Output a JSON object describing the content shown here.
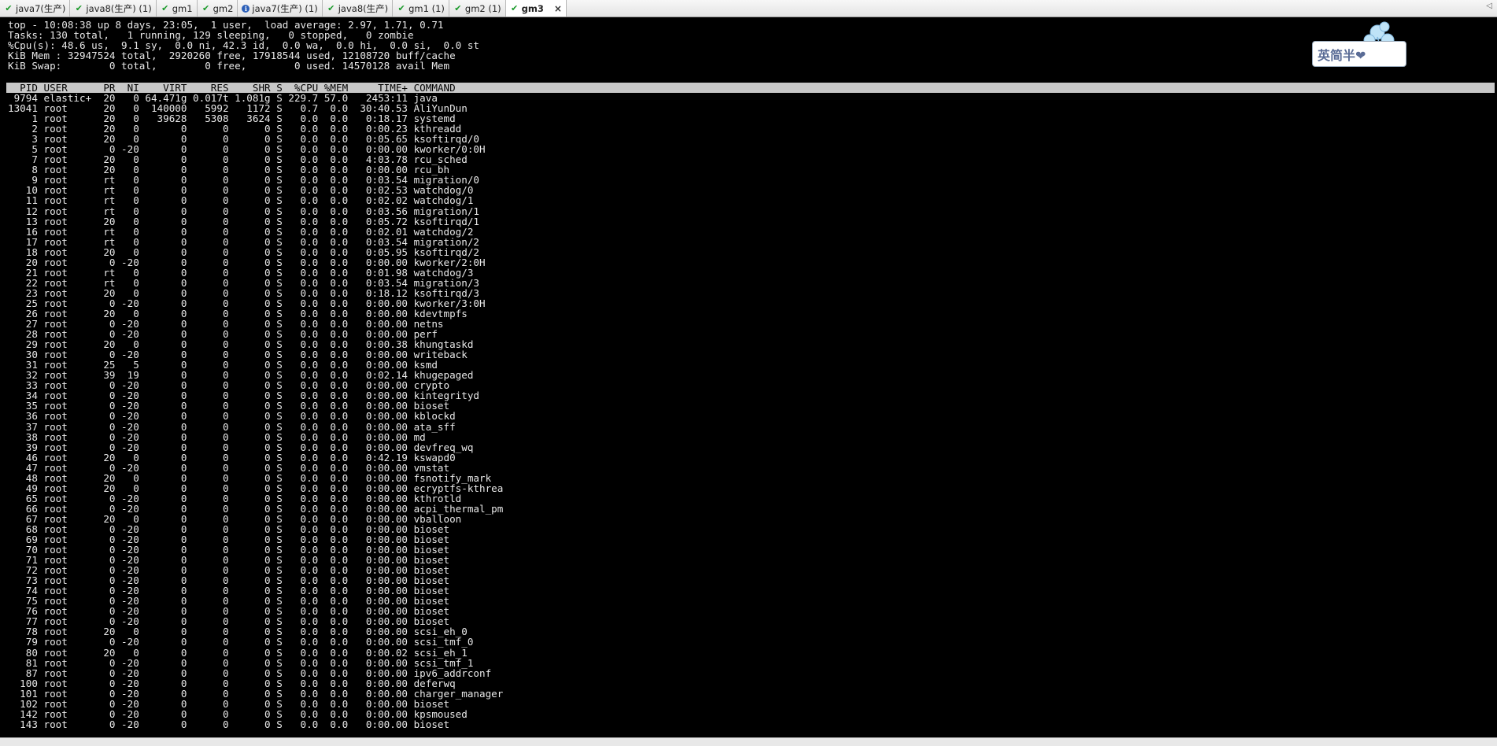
{
  "tabs": [
    {
      "label": "java7(生产)",
      "icon": "check-icon",
      "active": false
    },
    {
      "label": "java8(生产) (1)",
      "icon": "check-icon",
      "active": false
    },
    {
      "label": "gm1",
      "icon": "check-icon",
      "active": false
    },
    {
      "label": "gm2",
      "icon": "check-icon",
      "active": false
    },
    {
      "label": "java7(生产) (1)",
      "icon": "info-icon",
      "active": false
    },
    {
      "label": "java8(生产)",
      "icon": "check-icon",
      "active": false
    },
    {
      "label": "gm1 (1)",
      "icon": "check-icon",
      "active": false
    },
    {
      "label": "gm2 (1)",
      "icon": "check-icon",
      "active": false
    },
    {
      "label": "gm3",
      "icon": "check-icon",
      "active": true
    }
  ],
  "tab_close_label": "×",
  "tabbar_end_label": "◁",
  "logo_text": "英简半❤",
  "summary": [
    "top - 10:08:38 up 8 days, 23:05,  1 user,  load average: 2.97, 1.71, 0.71",
    "Tasks: 130 total,   1 running, 129 sleeping,   0 stopped,   0 zombie",
    "%Cpu(s): 48.6 us,  9.1 sy,  0.0 ni, 42.3 id,  0.0 wa,  0.0 hi,  0.0 si,  0.0 st",
    "KiB Mem : 32947524 total,  2920260 free, 17918544 used, 12108720 buff/cache",
    "KiB Swap:        0 total,        0 free,        0 used. 14570128 avail Mem"
  ],
  "column_header": "  PID USER      PR  NI    VIRT    RES    SHR S  %CPU %MEM     TIME+ COMMAND",
  "processes": [
    " 9794 elastic+  20   0 64.471g 0.017t 1.081g S 229.7 57.0   2453:11 java",
    "13041 root      20   0  140000   5992   1172 S   0.7  0.0  30:40.53 AliYunDun",
    "    1 root      20   0   39628   5308   3624 S   0.0  0.0   0:18.17 systemd",
    "    2 root      20   0       0      0      0 S   0.0  0.0   0:00.23 kthreadd",
    "    3 root      20   0       0      0      0 S   0.0  0.0   0:05.65 ksoftirqd/0",
    "    5 root       0 -20       0      0      0 S   0.0  0.0   0:00.00 kworker/0:0H",
    "    7 root      20   0       0      0      0 S   0.0  0.0   4:03.78 rcu_sched",
    "    8 root      20   0       0      0      0 S   0.0  0.0   0:00.00 rcu_bh",
    "    9 root      rt   0       0      0      0 S   0.0  0.0   0:03.54 migration/0",
    "   10 root      rt   0       0      0      0 S   0.0  0.0   0:02.53 watchdog/0",
    "   11 root      rt   0       0      0      0 S   0.0  0.0   0:02.02 watchdog/1",
    "   12 root      rt   0       0      0      0 S   0.0  0.0   0:03.56 migration/1",
    "   13 root      20   0       0      0      0 S   0.0  0.0   0:05.72 ksoftirqd/1",
    "   16 root      rt   0       0      0      0 S   0.0  0.0   0:02.01 watchdog/2",
    "   17 root      rt   0       0      0      0 S   0.0  0.0   0:03.54 migration/2",
    "   18 root      20   0       0      0      0 S   0.0  0.0   0:05.95 ksoftirqd/2",
    "   20 root       0 -20       0      0      0 S   0.0  0.0   0:00.00 kworker/2:0H",
    "   21 root      rt   0       0      0      0 S   0.0  0.0   0:01.98 watchdog/3",
    "   22 root      rt   0       0      0      0 S   0.0  0.0   0:03.54 migration/3",
    "   23 root      20   0       0      0      0 S   0.0  0.0   0:18.12 ksoftirqd/3",
    "   25 root       0 -20       0      0      0 S   0.0  0.0   0:00.00 kworker/3:0H",
    "   26 root      20   0       0      0      0 S   0.0  0.0   0:00.00 kdevtmpfs",
    "   27 root       0 -20       0      0      0 S   0.0  0.0   0:00.00 netns",
    "   28 root       0 -20       0      0      0 S   0.0  0.0   0:00.00 perf",
    "   29 root      20   0       0      0      0 S   0.0  0.0   0:00.38 khungtaskd",
    "   30 root       0 -20       0      0      0 S   0.0  0.0   0:00.00 writeback",
    "   31 root      25   5       0      0      0 S   0.0  0.0   0:00.00 ksmd",
    "   32 root      39  19       0      0      0 S   0.0  0.0   0:02.14 khugepaged",
    "   33 root       0 -20       0      0      0 S   0.0  0.0   0:00.00 crypto",
    "   34 root       0 -20       0      0      0 S   0.0  0.0   0:00.00 kintegrityd",
    "   35 root       0 -20       0      0      0 S   0.0  0.0   0:00.00 bioset",
    "   36 root       0 -20       0      0      0 S   0.0  0.0   0:00.00 kblockd",
    "   37 root       0 -20       0      0      0 S   0.0  0.0   0:00.00 ata_sff",
    "   38 root       0 -20       0      0      0 S   0.0  0.0   0:00.00 md",
    "   39 root       0 -20       0      0      0 S   0.0  0.0   0:00.00 devfreq_wq",
    "   46 root      20   0       0      0      0 S   0.0  0.0   0:42.19 kswapd0",
    "   47 root       0 -20       0      0      0 S   0.0  0.0   0:00.00 vmstat",
    "   48 root      20   0       0      0      0 S   0.0  0.0   0:00.00 fsnotify_mark",
    "   49 root      20   0       0      0      0 S   0.0  0.0   0:00.00 ecryptfs-kthrea",
    "   65 root       0 -20       0      0      0 S   0.0  0.0   0:00.00 kthrotld",
    "   66 root       0 -20       0      0      0 S   0.0  0.0   0:00.00 acpi_thermal_pm",
    "   67 root      20   0       0      0      0 S   0.0  0.0   0:00.00 vballoon",
    "   68 root       0 -20       0      0      0 S   0.0  0.0   0:00.00 bioset",
    "   69 root       0 -20       0      0      0 S   0.0  0.0   0:00.00 bioset",
    "   70 root       0 -20       0      0      0 S   0.0  0.0   0:00.00 bioset",
    "   71 root       0 -20       0      0      0 S   0.0  0.0   0:00.00 bioset",
    "   72 root       0 -20       0      0      0 S   0.0  0.0   0:00.00 bioset",
    "   73 root       0 -20       0      0      0 S   0.0  0.0   0:00.00 bioset",
    "   74 root       0 -20       0      0      0 S   0.0  0.0   0:00.00 bioset",
    "   75 root       0 -20       0      0      0 S   0.0  0.0   0:00.00 bioset",
    "   76 root       0 -20       0      0      0 S   0.0  0.0   0:00.00 bioset",
    "   77 root       0 -20       0      0      0 S   0.0  0.0   0:00.00 bioset",
    "   78 root      20   0       0      0      0 S   0.0  0.0   0:00.00 scsi_eh_0",
    "   79 root       0 -20       0      0      0 S   0.0  0.0   0:00.00 scsi_tmf_0",
    "   80 root      20   0       0      0      0 S   0.0  0.0   0:00.02 scsi_eh_1",
    "   81 root       0 -20       0      0      0 S   0.0  0.0   0:00.00 scsi_tmf_1",
    "   87 root       0 -20       0      0      0 S   0.0  0.0   0:00.00 ipv6_addrconf",
    "  100 root       0 -20       0      0      0 S   0.0  0.0   0:00.00 deferwq",
    "  101 root       0 -20       0      0      0 S   0.0  0.0   0:00.00 charger_manager",
    "  102 root       0 -20       0      0      0 S   0.0  0.0   0:00.00 bioset",
    "  142 root       0 -20       0      0      0 S   0.0  0.0   0:00.00 kpsmoused",
    "  143 root       0 -20       0      0      0 S   0.0  0.0   0:00.00 bioset"
  ]
}
